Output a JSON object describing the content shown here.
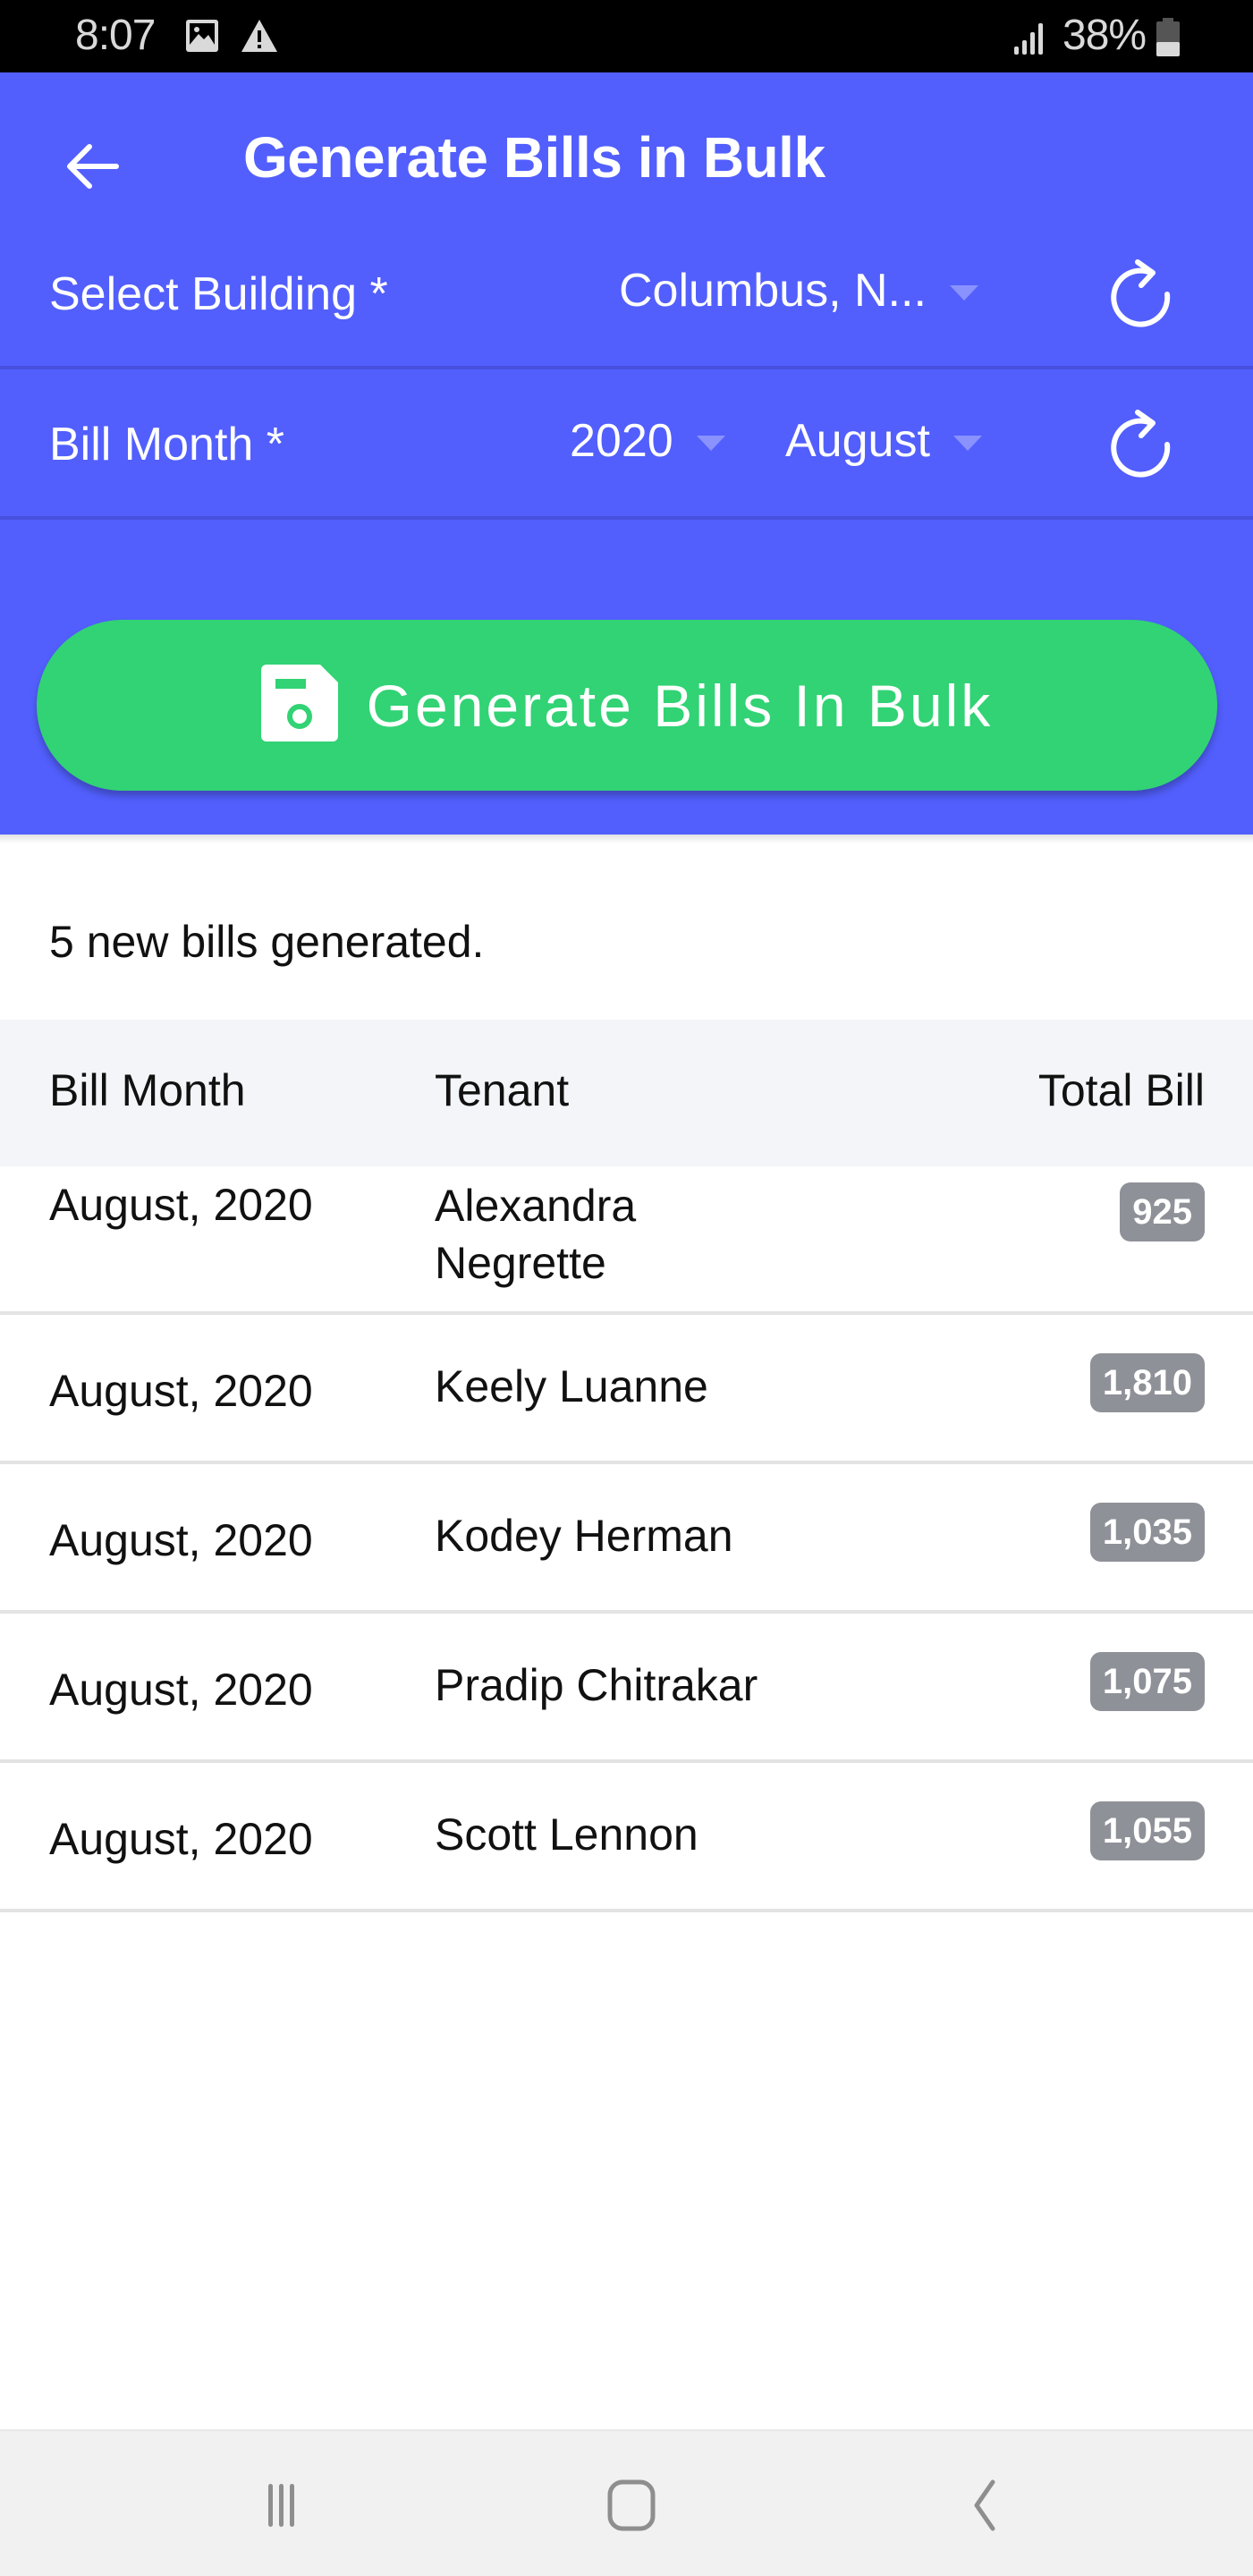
{
  "status_bar": {
    "time": "8:07",
    "notification_icons": [
      "gallery-icon",
      "warning-icon"
    ],
    "signal_icon": "signal-icon",
    "battery_percent": "38%",
    "battery_level": 0.38
  },
  "header": {
    "back_icon": "arrow-left-icon",
    "title": "Generate Bills in Bulk",
    "colors": {
      "primary": "#525ffd",
      "button": "#31d374"
    }
  },
  "form": {
    "building": {
      "label": "Select Building *",
      "value": "Columbus, N...",
      "refresh_icon": "refresh-icon"
    },
    "bill_month": {
      "label": "Bill Month *",
      "year_value": "2020",
      "month_value": "August",
      "refresh_icon": "refresh-icon"
    },
    "generate_button": {
      "icon": "save-icon",
      "label": "Generate Bills In Bulk"
    }
  },
  "results": {
    "summary": "5 new bills generated.",
    "columns": [
      "Bill Month",
      "Tenant",
      "Total Bill"
    ],
    "rows": [
      {
        "month": "August, 2020",
        "tenant": "Alexandra Negrette",
        "total": "925"
      },
      {
        "month": "August, 2020",
        "tenant": "Keely Luanne",
        "total": "1,810"
      },
      {
        "month": "August, 2020",
        "tenant": "Kodey Herman",
        "total": "1,035"
      },
      {
        "month": "August, 2020",
        "tenant": "Pradip Chitrakar",
        "total": "1,075"
      },
      {
        "month": "August, 2020",
        "tenant": "Scott Lennon",
        "total": "1,055"
      }
    ]
  },
  "nav_bar": {
    "recents_icon": "recents-icon",
    "home_icon": "home-icon",
    "back_icon": "back-icon"
  }
}
